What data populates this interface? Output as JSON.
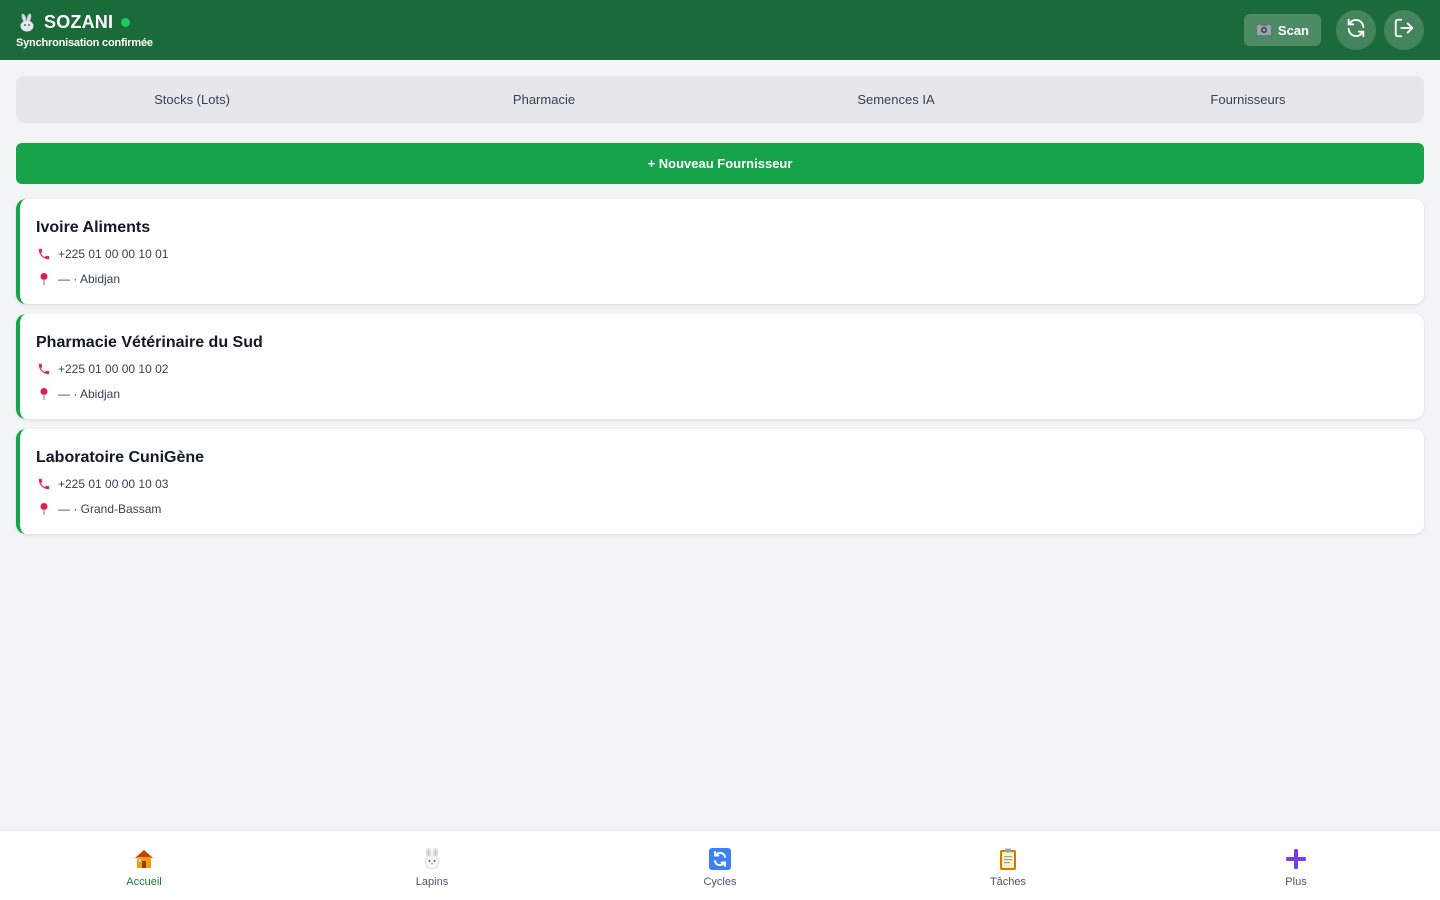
{
  "header": {
    "title": "SOZANI",
    "subtitle": "Synchronisation confirmée",
    "scan_label": "Scan",
    "status_color": "#22c55e"
  },
  "tabs": [
    {
      "label": "Stocks (Lots)"
    },
    {
      "label": "Pharmacie"
    },
    {
      "label": "Semences IA"
    },
    {
      "label": "Fournisseurs"
    }
  ],
  "new_supplier_label": "+ Nouveau Fournisseur",
  "suppliers": [
    {
      "name": "Ivoire Aliments",
      "phone": "+225 01 00 00 10 01",
      "location": "— · Abidjan"
    },
    {
      "name": "Pharmacie Vétérinaire du Sud",
      "phone": "+225 01 00 00 10 02",
      "location": "— · Abidjan"
    },
    {
      "name": "Laboratoire CuniGène",
      "phone": "+225 01 00 00 10 03",
      "location": "— · Grand-Bassam"
    }
  ],
  "nav": [
    {
      "label": "Accueil",
      "icon": "house-icon"
    },
    {
      "label": "Lapins",
      "icon": "rabbit-icon"
    },
    {
      "label": "Cycles",
      "icon": "cycle-icon"
    },
    {
      "label": "Tâches",
      "icon": "clipboard-icon"
    },
    {
      "label": "Plus",
      "icon": "plus-icon"
    }
  ],
  "colors": {
    "header_bg": "#1b6b3a",
    "accent": "#16a34a",
    "active_nav": "#15803d"
  }
}
